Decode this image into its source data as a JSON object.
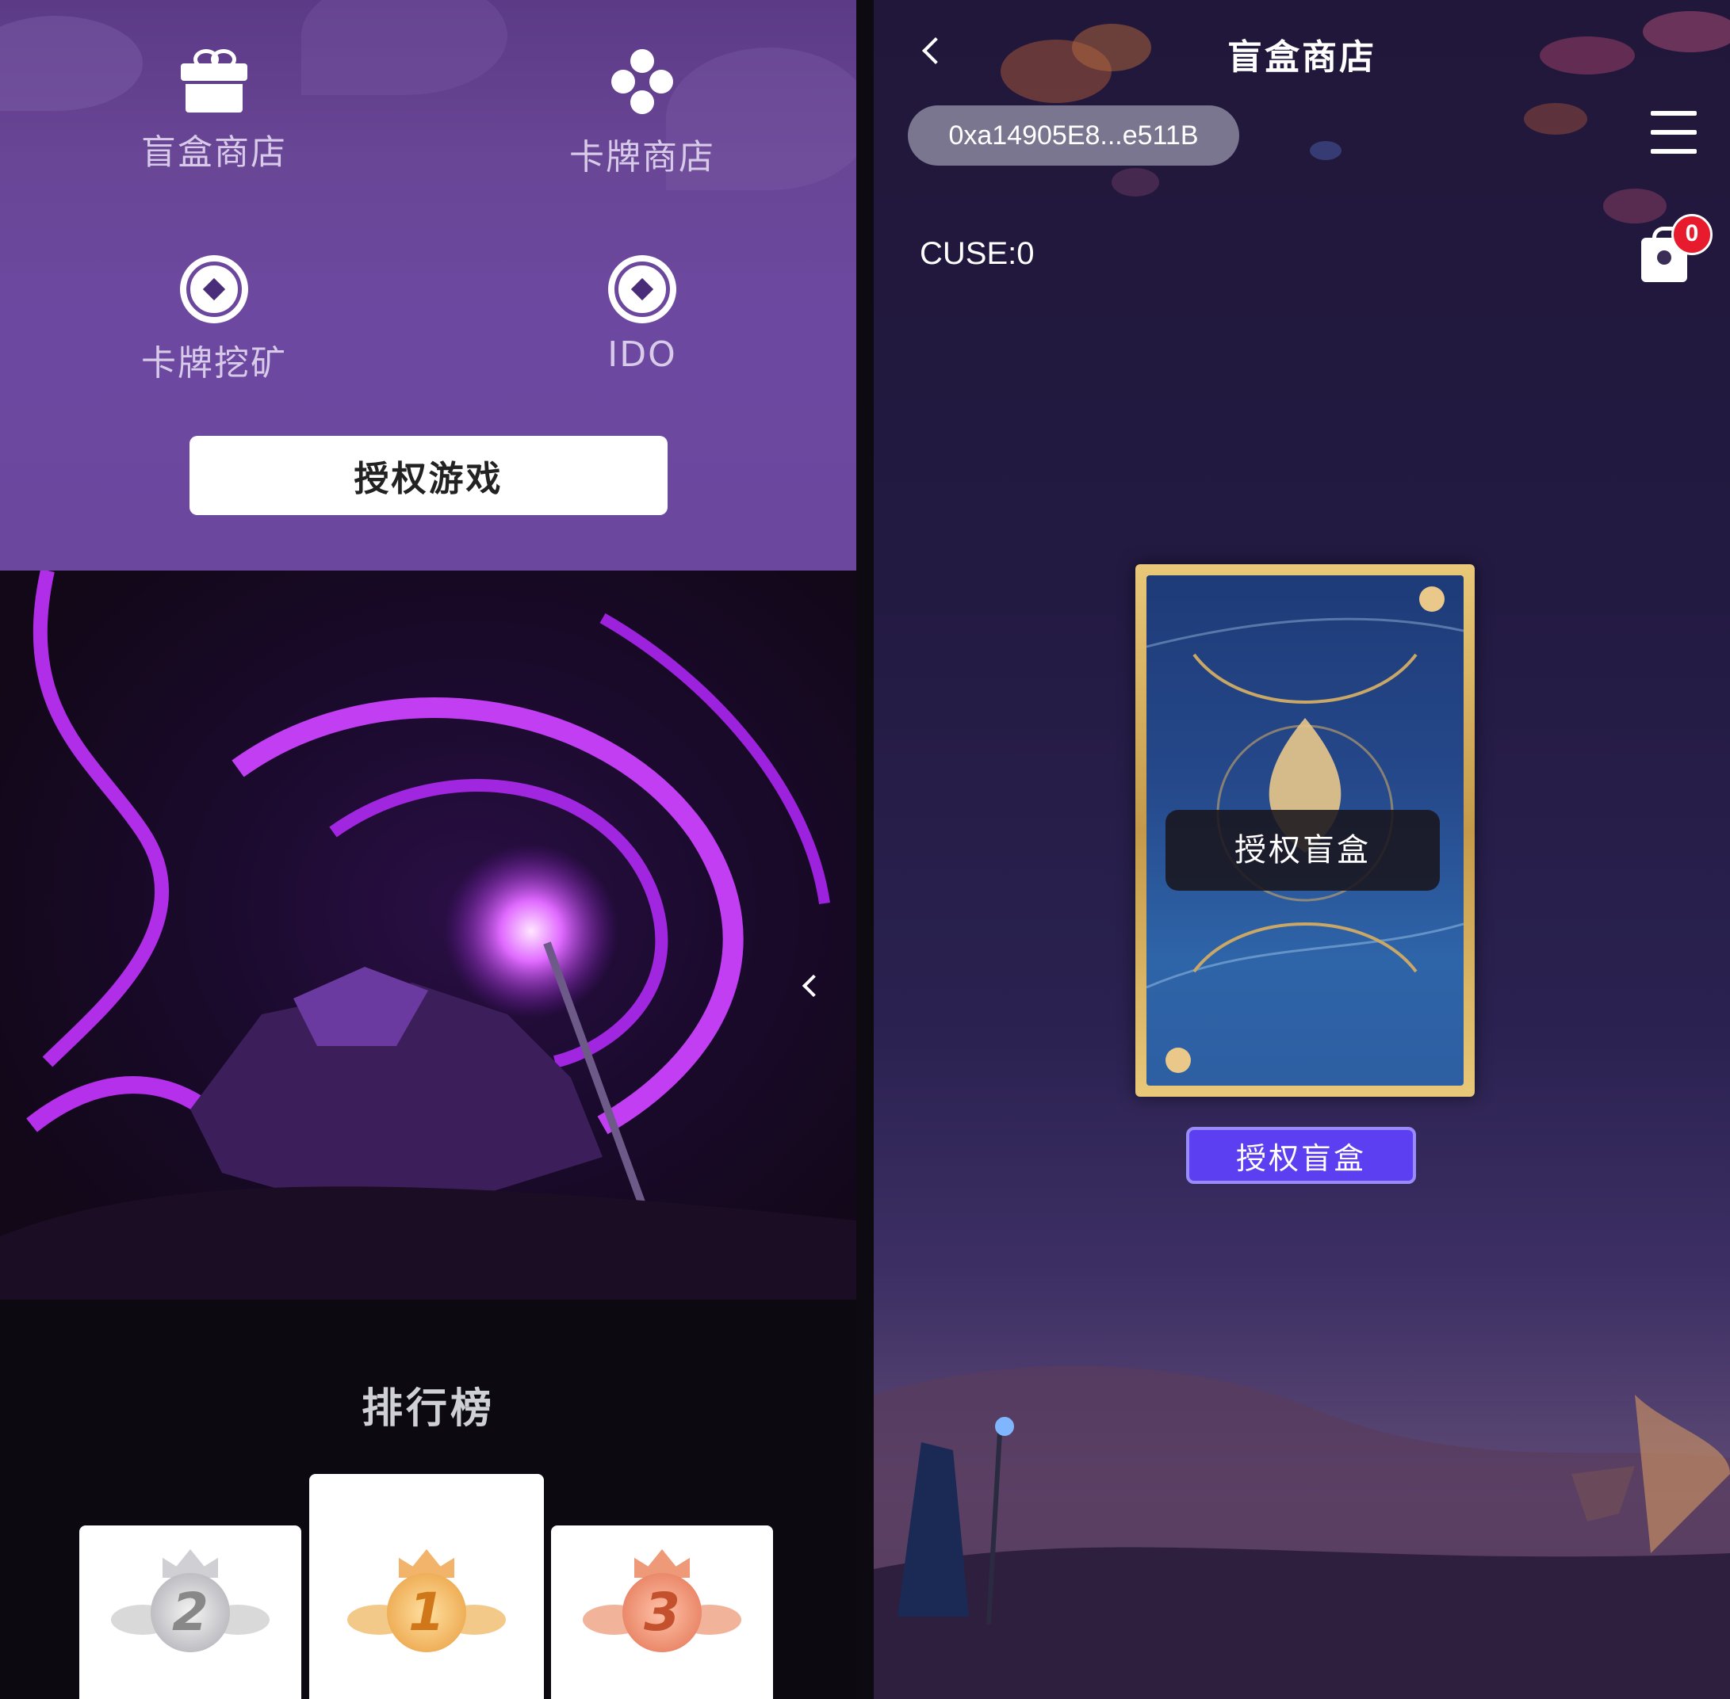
{
  "left": {
    "menu": [
      {
        "label": "盲盒商店",
        "icon": "gift-icon"
      },
      {
        "label": "卡牌商店",
        "icon": "clover-icon"
      },
      {
        "label": "卡牌挖矿",
        "icon": "coin-icon"
      },
      {
        "label": "IDO",
        "icon": "coin-icon"
      }
    ],
    "auth_game_label": "授权游戏",
    "carousel_prev_icon": "chevron-left-icon",
    "leaderboard": {
      "title": "排行榜",
      "ranks": [
        "2",
        "1",
        "3"
      ]
    }
  },
  "right": {
    "back_icon": "chevron-left-icon",
    "title": "盲盒商店",
    "wallet_address": "0xa14905E8...e511B",
    "menu_icon": "hamburger-icon",
    "balance": "CUSE:0",
    "cart_icon": "shopping-bag-icon",
    "cart_count": "0",
    "card_overlay_label": "授权盲盒",
    "auth_box_label": "授权盲盒"
  },
  "colors": {
    "accent_purple": "#5b3ff0",
    "badge_red": "#e81a2e",
    "menu_bg": "#6b479e"
  }
}
